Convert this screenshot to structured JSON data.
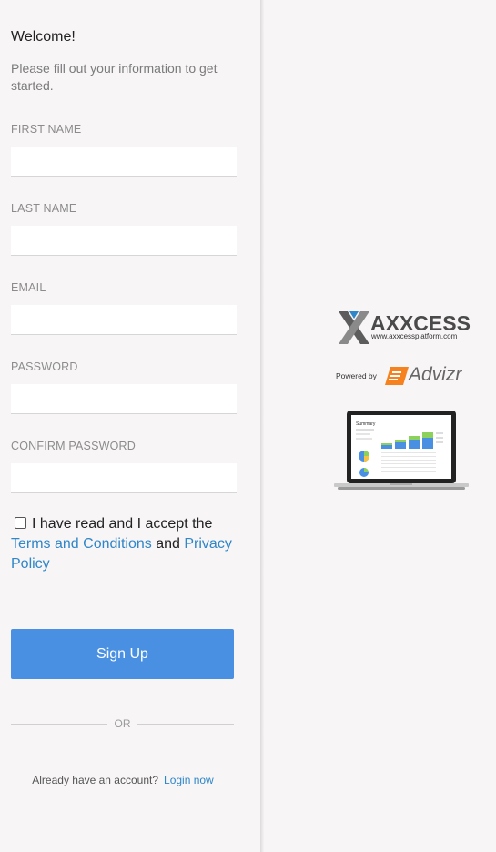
{
  "signup": {
    "welcome": "Welcome!",
    "intro": "Please fill out your information to get started.",
    "fields": {
      "first_name": "FIRST NAME",
      "last_name": "LAST NAME",
      "email": "EMAIL",
      "password": "PASSWORD",
      "confirm_password": "CONFIRM PASSWORD"
    },
    "terms": {
      "prefix": "I have read and I accept the",
      "terms_link": "Terms and Conditions",
      "and": "and",
      "privacy_link": "Privacy Policy",
      "checked": false
    },
    "button": "Sign Up",
    "or": "OR",
    "account_prompt": "Already have an account?",
    "login_link": "Login now"
  },
  "branding": {
    "brand_name": "AXXCESS",
    "brand_url": "www.axxcessplatform.com",
    "powered_by": "Powered by",
    "partner_name": "Advizr",
    "laptop_title": "Summary",
    "colors": {
      "button": "#4a90e2",
      "link": "#2f86c8",
      "advizr_orange": "#f5821f",
      "logo_gray": "#4a4a4a"
    }
  }
}
